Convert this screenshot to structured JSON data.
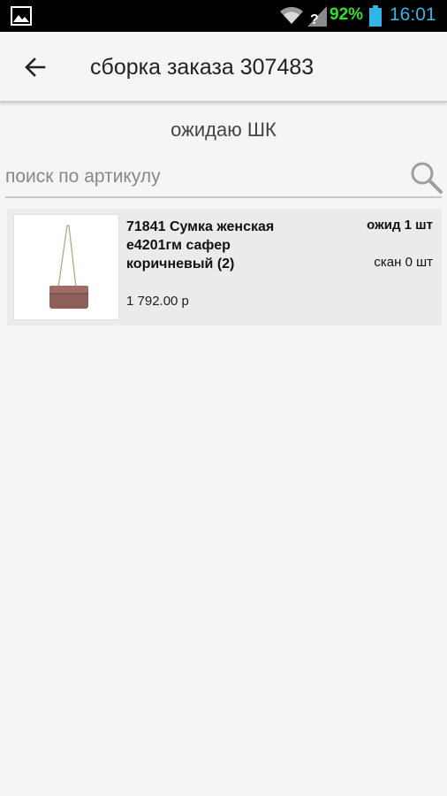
{
  "status_bar": {
    "battery_percent": "92%",
    "time": "16:01",
    "colors": {
      "battery_text": "#2ee02e",
      "clock": "#33b5e5"
    },
    "icons": [
      "gallery-icon",
      "wifi-icon",
      "signal-icon",
      "battery-icon"
    ]
  },
  "app_bar": {
    "title": "сборка заказа 307483",
    "back_icon": "arrow-back-icon"
  },
  "status_text": "ожидаю ШК",
  "search": {
    "placeholder": "поиск по артикулу",
    "value": "",
    "icon": "search-icon"
  },
  "items": [
    {
      "name": "71841 Сумка женская е4201гм сафер коричневый (2)",
      "price": "1 792.00 р",
      "expected": "ожид 1 шт",
      "scanned": "скан 0 шт",
      "image": "handbag-image"
    }
  ]
}
